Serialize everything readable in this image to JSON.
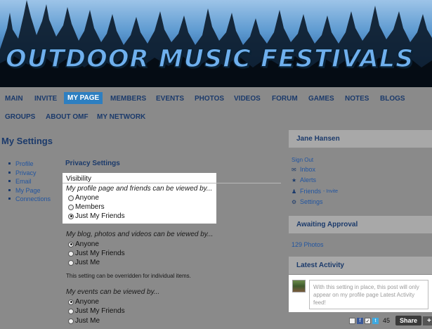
{
  "banner": {
    "title": "OUTDOOR MUSIC FESTIVALS"
  },
  "nav": {
    "row1": [
      "MAIN",
      "INVITE",
      "MY PAGE",
      "MEMBERS",
      "EVENTS",
      "PHOTOS",
      "VIDEOS",
      "FORUM",
      "GAMES",
      "NOTES",
      "BLOGS"
    ],
    "row2": [
      "GROUPS",
      "ABOUT OMF",
      "MY NETWORK"
    ],
    "active": "MY PAGE"
  },
  "page": {
    "title": "My Settings"
  },
  "settings_menu": [
    "Profile",
    "Privacy",
    "Email",
    "My Page",
    "Connections"
  ],
  "privacy": {
    "heading": "Privacy Settings",
    "section": "Visibility",
    "q1": "My profile page and friends can be viewed by...",
    "q1_options": [
      "Anyone",
      "Members",
      "Just My Friends"
    ],
    "q1_selected": "Just My Friends",
    "q2": "My blog, photos and videos can be viewed by...",
    "q2_options": [
      "Anyone",
      "Just My Friends",
      "Just Me"
    ],
    "q2_selected": "Anyone",
    "note": "This setting can be overridden for individual items.",
    "q3": "My events can be viewed by...",
    "q3_options": [
      "Anyone",
      "Just My Friends",
      "Just Me"
    ],
    "q3_selected": "Anyone"
  },
  "sidebar": {
    "user_name": "Jane Hansen",
    "sign_out": "Sign Out",
    "links": {
      "inbox": "Inbox",
      "alerts": "Alerts",
      "friends": "Friends",
      "invite": "Invite",
      "settings": "Settings"
    },
    "awaiting_header": "Awaiting Approval",
    "photos_link": "129 Photos",
    "activity_header": "Latest Activity",
    "activity_text": "With this setting in place, this post will only appear on my profile page Latest Activity feed!"
  },
  "share": {
    "count": "45",
    "label": "Share",
    "plus": "+"
  },
  "colors": {
    "nav_text": "#1b3a6b",
    "nav_active_bg": "#2d7fc1",
    "link": "#2255a0",
    "page_bg": "#8a8a8a"
  }
}
